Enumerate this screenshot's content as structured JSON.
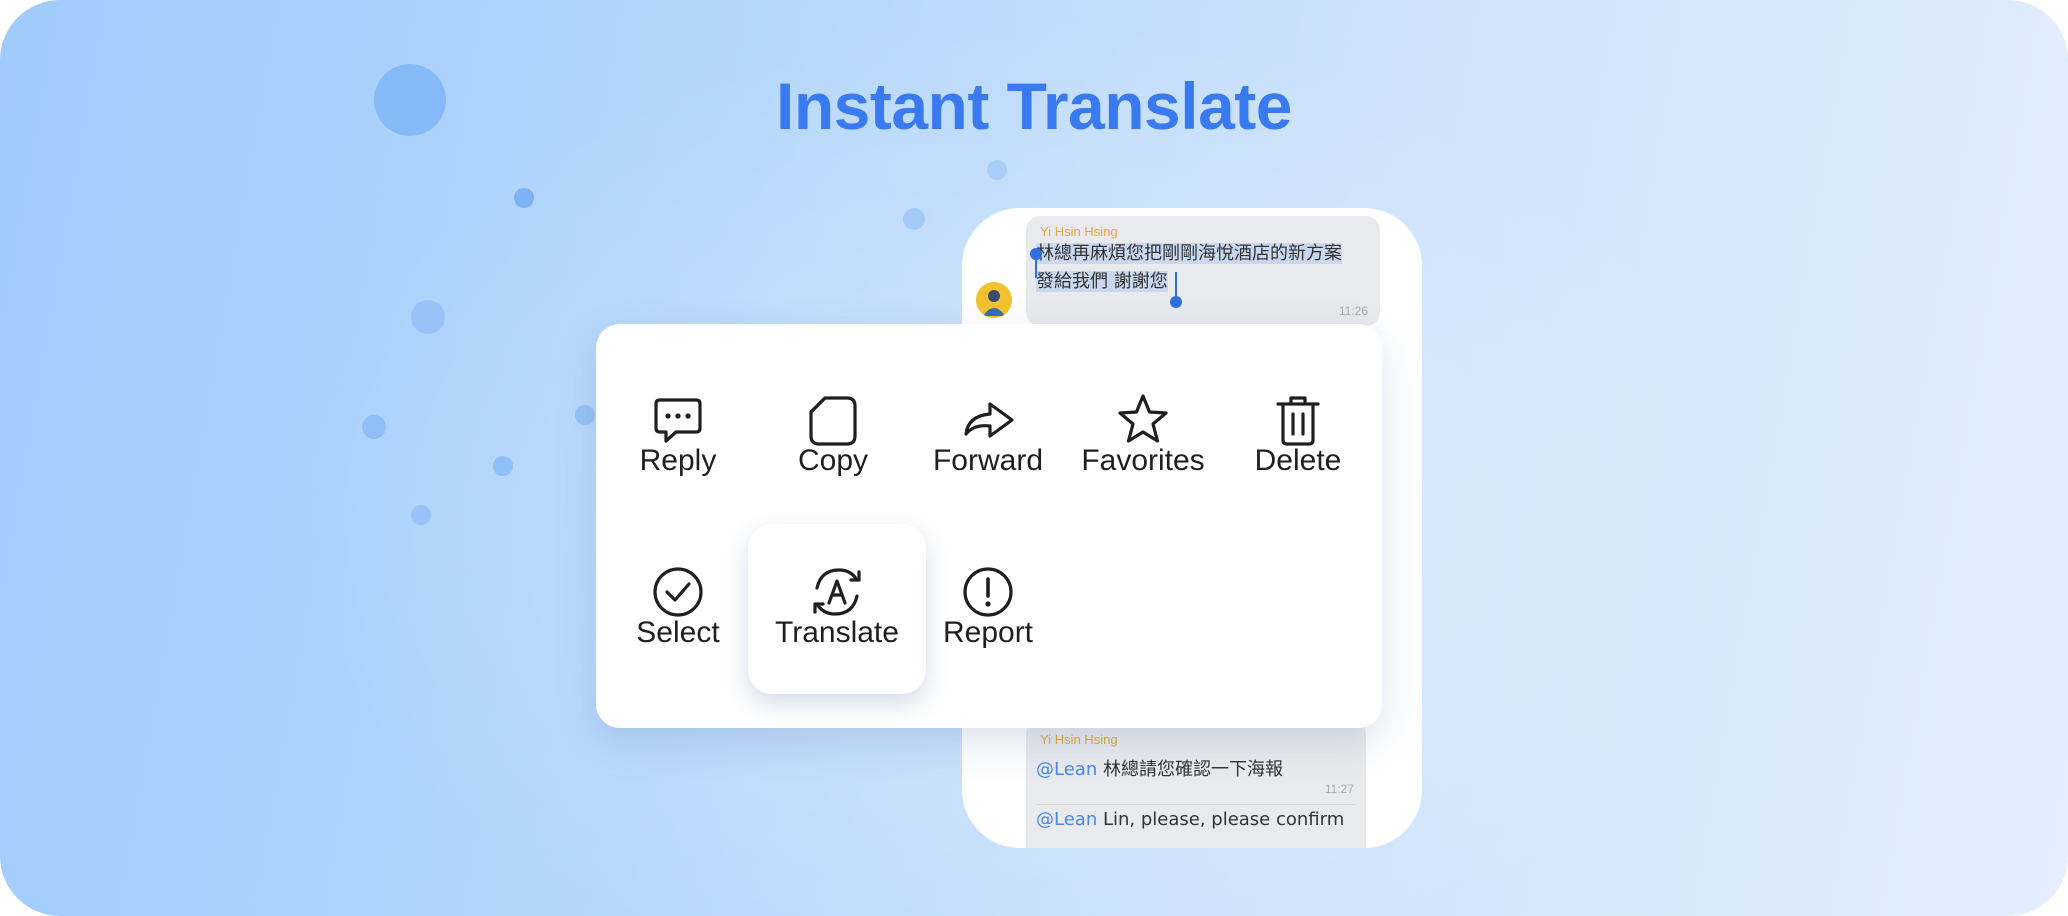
{
  "page": {
    "title": "Instant Translate"
  },
  "chat": {
    "messages": [
      {
        "sender": "Yi Hsin Hsing",
        "line1": "林總再麻煩您把剛剛海悅酒店的新方案",
        "line2": "發給我們 謝謝您",
        "time": "11:26",
        "selected": true
      },
      {
        "sender": "Yi Hsin Hsing",
        "mention": "@Lean",
        "text": "林總請您確認一下海報",
        "time": "11:27",
        "translation_mention": "@Lean",
        "translation_text": "Lin, please, please confirm"
      }
    ]
  },
  "menu": {
    "items": [
      {
        "label": "Reply",
        "icon": "reply-chat-bubble-icon"
      },
      {
        "label": "Copy",
        "icon": "copy-document-icon"
      },
      {
        "label": "Forward",
        "icon": "forward-arrow-icon"
      },
      {
        "label": "Favorites",
        "icon": "star-icon"
      },
      {
        "label": "Delete",
        "icon": "trash-icon"
      },
      {
        "label": "Select",
        "icon": "checkmark-circle-icon"
      },
      {
        "label": "Translate",
        "icon": "translate-icon",
        "highlighted": true
      },
      {
        "label": "Report",
        "icon": "exclamation-circle-icon"
      }
    ]
  },
  "colors": {
    "title": "#3a7af0",
    "selection_handle": "#2f6fe0",
    "sender_name": "#e3a83b",
    "mention": "#4a86e8"
  }
}
